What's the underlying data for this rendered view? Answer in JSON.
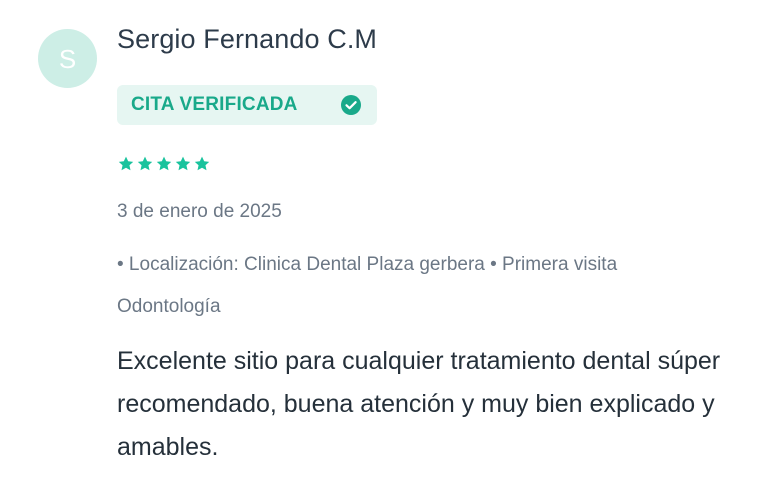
{
  "review": {
    "avatar_initial": "S",
    "reviewer_name": "Sergio Fernando C.M",
    "badge": {
      "label": "CITA VERIFICADA",
      "icon": "check-circle-icon",
      "color": "#19a98a",
      "background": "#e6f6f2"
    },
    "rating": {
      "value": 5,
      "max": 5,
      "color": "#19c39d"
    },
    "date": "3 de enero de 2025",
    "meta": "• Localización: Clinica Dental Plaza gerbera • Primera visita Odontología",
    "text": "Excelente sitio para cualquier tratamiento dental súper recomendado, buena atención y muy bien explicado y amables."
  }
}
